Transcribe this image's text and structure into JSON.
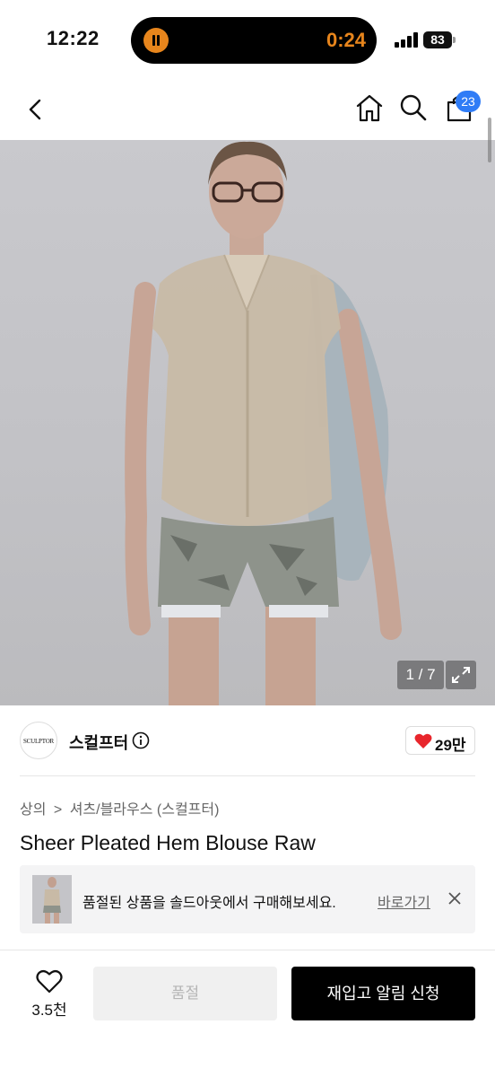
{
  "status_bar": {
    "time": "12:22",
    "recording_timer": "0:24",
    "battery": "83",
    "accent_color": "#e7851c"
  },
  "nav": {
    "cart_count": "23",
    "icons": [
      "chevron-left-icon",
      "home-icon",
      "search-icon",
      "shopping-bag-icon"
    ]
  },
  "gallery": {
    "pager": "1 / 7"
  },
  "brand": {
    "logo_text": "SCULPTOR",
    "name": "스컬프터",
    "likes": "29만"
  },
  "product": {
    "breadcrumb": [
      "상의",
      ">",
      "셔츠/블라우스 (스컬프터)"
    ],
    "title": "Sheer Pleated Hem Blouse Raw"
  },
  "banner": {
    "message": "품절된 상품을 솔드아웃에서 구매해보세요.",
    "link": "바로가기"
  },
  "bottom_bar": {
    "wish_count": "3.5천",
    "soldout_label": "품절",
    "restock_label": "재입고 알림 신청"
  }
}
